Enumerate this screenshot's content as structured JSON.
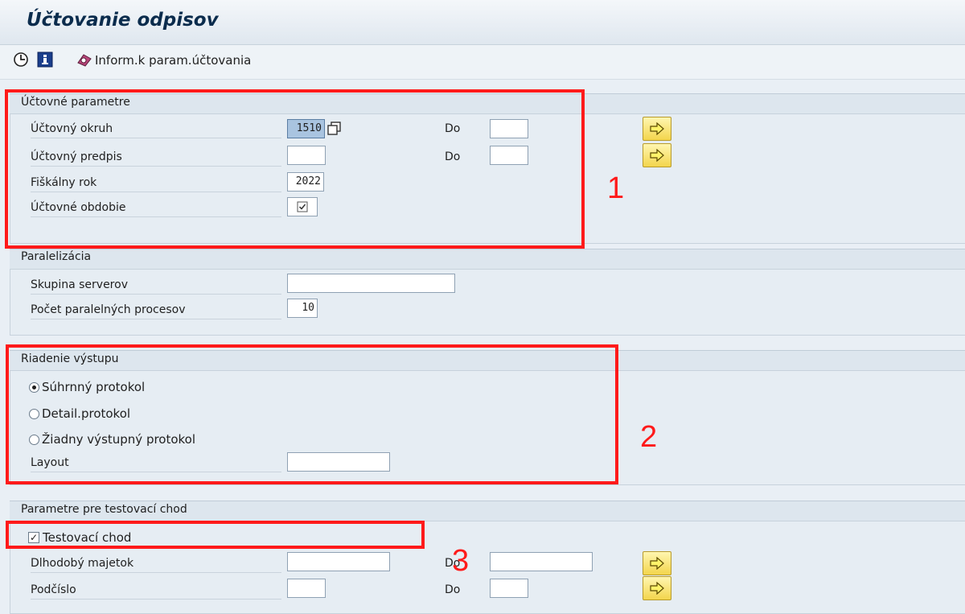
{
  "window": {
    "title": "Účtovanie odpisov"
  },
  "toolbar": {
    "info_label": "Inform.k param.účtovania"
  },
  "posting": {
    "title": "Účtovné parametre",
    "company_code_label": "Účtovný okruh",
    "company_code_value": "1510",
    "posting_rule_label": "Účtovný predpis",
    "posting_rule_value": "",
    "fiscal_year_label": "Fiškálny rok",
    "fiscal_year_value": "2022",
    "period_label": "Účtovné obdobie",
    "to_label": "Do"
  },
  "parallel": {
    "title": "Paralelizácia",
    "server_group_label": "Skupina serverov",
    "server_group_value": "",
    "processes_label": "Počet paralelných procesov",
    "processes_value": "10"
  },
  "output": {
    "title": "Riadenie výstupu",
    "options": [
      {
        "label": "Súhrnný protokol",
        "selected": true
      },
      {
        "label": "Detail.protokol",
        "selected": false
      },
      {
        "label": "Žiadny výstupný protokol",
        "selected": false
      }
    ],
    "layout_label": "Layout",
    "layout_value": ""
  },
  "test": {
    "title": "Parametre pre testovací chod",
    "test_run_label": "Testovací chod",
    "test_run_checked": true,
    "asset_label": "Dlhodobý majetok",
    "subnumber_label": "Podčíslo",
    "to_label": "Do"
  },
  "annotations": {
    "one": "1",
    "two": "2",
    "three": "3"
  },
  "colors": {
    "highlight": "#ff1a1a",
    "button": "#f3d54c",
    "background": "#e9eff5"
  }
}
